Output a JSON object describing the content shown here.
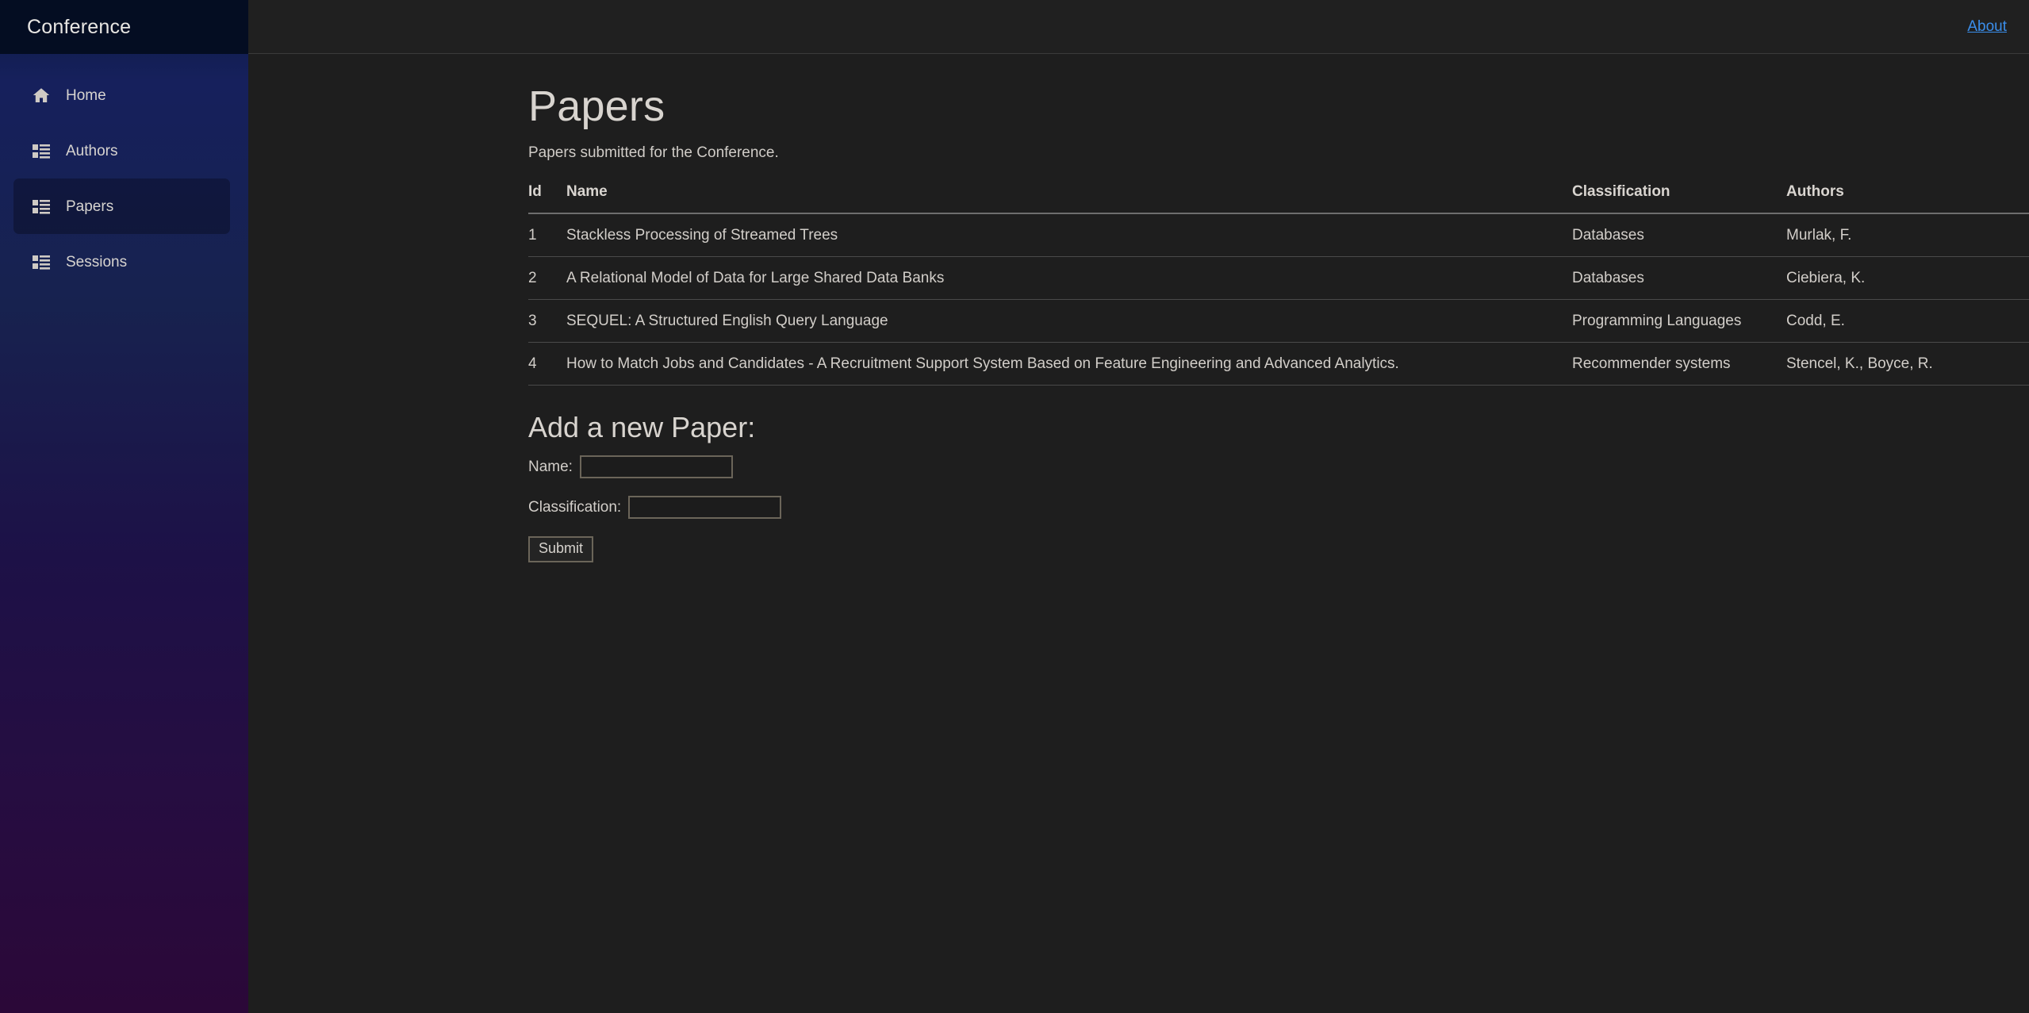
{
  "sidebar": {
    "brand": "Conference",
    "items": [
      {
        "label": "Home",
        "icon": "home-icon",
        "active": false
      },
      {
        "label": "Authors",
        "icon": "list-icon",
        "active": false
      },
      {
        "label": "Papers",
        "icon": "list-icon",
        "active": true
      },
      {
        "label": "Sessions",
        "icon": "list-icon",
        "active": false
      }
    ]
  },
  "topbar": {
    "about_label": "About"
  },
  "page": {
    "title": "Papers",
    "subtitle": "Papers submitted for the Conference."
  },
  "table": {
    "headers": [
      "Id",
      "Name",
      "Classification",
      "Authors"
    ],
    "rows": [
      {
        "id": "1",
        "name": "Stackless Processing of Streamed Trees",
        "classification": "Databases",
        "authors": "Murlak, F."
      },
      {
        "id": "2",
        "name": "A Relational Model of Data for Large Shared Data Banks",
        "classification": "Databases",
        "authors": "Ciebiera, K."
      },
      {
        "id": "3",
        "name": "SEQUEL: A Structured English Query Language",
        "classification": "Programming Languages",
        "authors": "Codd, E."
      },
      {
        "id": "4",
        "name": "How to Match Jobs and Candidates - A Recruitment Support System Based on Feature Engineering and Advanced Analytics.",
        "classification": "Recommender systems",
        "authors": "Stencel, K., Boyce, R."
      }
    ]
  },
  "form": {
    "title": "Add a new Paper:",
    "name_label": "Name:",
    "name_value": "",
    "name_placeholder": "",
    "classification_label": "Classification:",
    "classification_value": "",
    "classification_placeholder": "",
    "submit_label": "Submit"
  },
  "colors": {
    "link": "#3b8eea",
    "sidebar_top": "#040d22",
    "sidebar_gradient_start": "#0d1c45",
    "sidebar_gradient_end": "#2b0838",
    "content_bg": "#1e1e1e",
    "text": "#d2cec9",
    "input_border": "#6b6559"
  }
}
